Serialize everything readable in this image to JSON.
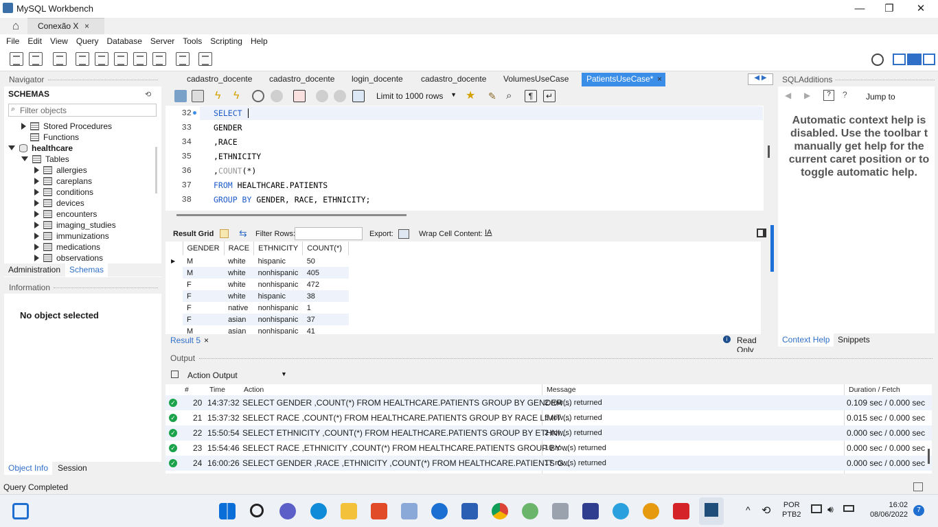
{
  "window": {
    "title": "MySQL Workbench",
    "tab_label": "Conexão X",
    "tab_close": "×",
    "minimize": "—",
    "maximize": "❐",
    "close": "✕"
  },
  "menu": [
    "File",
    "Edit",
    "View",
    "Query",
    "Database",
    "Server",
    "Tools",
    "Scripting",
    "Help"
  ],
  "navigator": {
    "header": "Navigator",
    "schemas_title": "SCHEMAS",
    "filter_placeholder": "Filter objects",
    "items": [
      {
        "label": "Stored Procedures"
      },
      {
        "label": "Functions"
      },
      {
        "label": "healthcare"
      },
      {
        "label": "Tables"
      },
      {
        "label": "allergies"
      },
      {
        "label": "careplans"
      },
      {
        "label": "conditions"
      },
      {
        "label": "devices"
      },
      {
        "label": "encounters"
      },
      {
        "label": "imaging_studies"
      },
      {
        "label": "immunizations"
      },
      {
        "label": "medications"
      },
      {
        "label": "observations"
      }
    ],
    "tab_admin": "Administration",
    "tab_schemas": "Schemas"
  },
  "information": {
    "header": "Information",
    "message": "No object selected",
    "tab_objinfo": "Object Info",
    "tab_session": "Session"
  },
  "editor_tabs": [
    "cadastro_docente",
    "cadastro_docente",
    "login_docente",
    "cadastro_docente",
    "VolumesUseCase",
    "PatientsUseCase*"
  ],
  "editor_tab_close": "×",
  "sql_toolbar": {
    "limit": "Limit to 1000 rows"
  },
  "editor": {
    "line_numbers": [
      "32",
      "33",
      "34",
      "35",
      "36",
      "37",
      "38"
    ],
    "lines": {
      "l32": "SELECT",
      "l33": "GENDER",
      "l34": ",RACE",
      "l35": ",ETHNICITY",
      "l36_pre": ",",
      "l36_fn": "COUNT",
      "l36_post": "(*)",
      "l37_kw": "FROM",
      "l37_rest": " HEALTHCARE.PATIENTS",
      "l38_kw": "GROUP BY",
      "l38_rest": " GENDER, RACE, ETHNICITY;"
    }
  },
  "result_bar": {
    "result_grid": "Result Grid",
    "filter_rows": "Filter Rows:",
    "export": "Export:",
    "wrap": "Wrap Cell Content:"
  },
  "result_grid": {
    "headers": [
      "GENDER",
      "RACE",
      "ETHNICITY",
      "COUNT(*)"
    ],
    "rows": [
      [
        "M",
        "white",
        "hispanic",
        "50"
      ],
      [
        "M",
        "white",
        "nonhispanic",
        "405"
      ],
      [
        "F",
        "white",
        "nonhispanic",
        "472"
      ],
      [
        "F",
        "white",
        "hispanic",
        "38"
      ],
      [
        "F",
        "native",
        "nonhispanic",
        "1"
      ],
      [
        "F",
        "asian",
        "nonhispanic",
        "37"
      ],
      [
        "M",
        "asian",
        "nonhispanic",
        "41"
      ]
    ]
  },
  "result_tab": {
    "label": "Result 5",
    "close": "×",
    "readonly": "Read Only"
  },
  "output": {
    "header": "Output",
    "selector": "Action Output",
    "columns": {
      "num": "#",
      "time": "Time",
      "action": "Action",
      "message": "Message",
      "duration": "Duration / Fetch"
    },
    "rows": [
      {
        "num": "20",
        "time": "14:37:32",
        "action": "SELECT  GENDER ,COUNT(*) FROM HEALTHCARE.PATIENTS GROUP BY GENDER ...",
        "message": "2 row(s) returned",
        "duration": "0.109 sec / 0.000 sec"
      },
      {
        "num": "21",
        "time": "15:37:32",
        "action": "SELECT  RACE ,COUNT(*) FROM HEALTHCARE.PATIENTS GROUP BY RACE LIMIT ...",
        "message": "5 row(s) returned",
        "duration": "0.015 sec / 0.000 sec"
      },
      {
        "num": "22",
        "time": "15:50:54",
        "action": "SELECT  ETHNICITY ,COUNT(*) FROM HEALTHCARE.PATIENTS GROUP BY ETHNI...",
        "message": "2 row(s) returned",
        "duration": "0.000 sec / 0.000 sec"
      },
      {
        "num": "23",
        "time": "15:54:46",
        "action": "SELECT  RACE ,ETHNICITY ,COUNT(*) FROM HEALTHCARE.PATIENTS GROUP BY ...",
        "message": "10 row(s) returned",
        "duration": "0.000 sec / 0.000 sec"
      },
      {
        "num": "24",
        "time": "16:00:26",
        "action": "SELECT  GENDER ,RACE ,ETHNICITY ,COUNT(*) FROM HEALTHCARE.PATIENTS G...",
        "message": "17 row(s) returned",
        "duration": "0.000 sec / 0.000 sec"
      }
    ]
  },
  "sql_additions": {
    "header": "SQLAdditions",
    "jump_to": "Jump to",
    "help_lines": [
      "Automatic context help is",
      "disabled. Use the toolbar t",
      "manually get help for the",
      "current caret position or to",
      "toggle automatic help."
    ],
    "tab_context": "Context Help",
    "tab_snippets": "Snippets"
  },
  "status_bar": "Query Completed",
  "taskbar": {
    "lang": "POR",
    "layout": "PTB2",
    "time": "16:02",
    "date": "08/06/2022",
    "badge": "7"
  },
  "colors": {
    "accent": "#3b8ee8",
    "keyword": "#1c5ac9",
    "success": "#1aa34a"
  }
}
